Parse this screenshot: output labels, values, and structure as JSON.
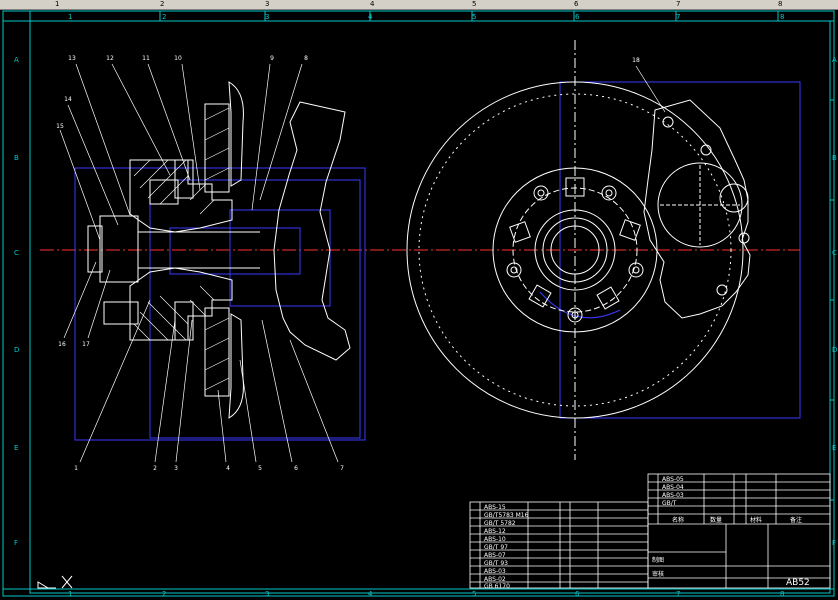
{
  "ruler": {
    "labels": [
      "1",
      "2",
      "3",
      "4",
      "5",
      "6",
      "7",
      "8"
    ]
  },
  "border": {
    "top_numbers": [
      "1",
      "2",
      "3",
      "4",
      "5",
      "6",
      "7",
      "8"
    ],
    "bottom_numbers": [
      "1",
      "2",
      "3",
      "4",
      "5",
      "6",
      "7",
      "8"
    ],
    "left_letters": [
      "A",
      "B",
      "C",
      "D",
      "E",
      "F"
    ],
    "right_letters": [
      "A",
      "B",
      "C",
      "D",
      "E",
      "F"
    ]
  },
  "balloons": {
    "b1": "1",
    "b2": "2",
    "b3": "3",
    "b4": "4",
    "b5": "5",
    "b6": "6",
    "b7": "7",
    "b8": "8",
    "b9": "9",
    "b10": "10",
    "b11": "11",
    "b12": "12",
    "b13": "13",
    "b14": "14",
    "b15": "15",
    "b16": "16",
    "b17": "17",
    "b18": "18"
  },
  "title_block": {
    "drawing_no": "AB52",
    "r1": "ABS-05",
    "r2": "ABS-04",
    "r3": "ABS-03",
    "r4": "GB/T",
    "h_name": "名称",
    "h_qty": "数量",
    "h_mat": "材料",
    "h_note": "备注",
    "t_draw": "制图",
    "t_check": "审核",
    "bl1": "ABS-15",
    "bl2": "GB/T5783 M16",
    "bl3": "GB/T 5782",
    "bl4": "ABS-12",
    "bl5": "ABS-10",
    "bl6": "GB/T 97",
    "bl7": "ABS-07",
    "bl8": "GB/T 93",
    "bl9": "ABS-03",
    "bl10": "ABS-02",
    "bl11": "GB 6170"
  },
  "colors": {
    "line": "#ffffff",
    "hidden": "#3a3aff",
    "center": "#ff3030",
    "frame": "#00c8c8"
  }
}
